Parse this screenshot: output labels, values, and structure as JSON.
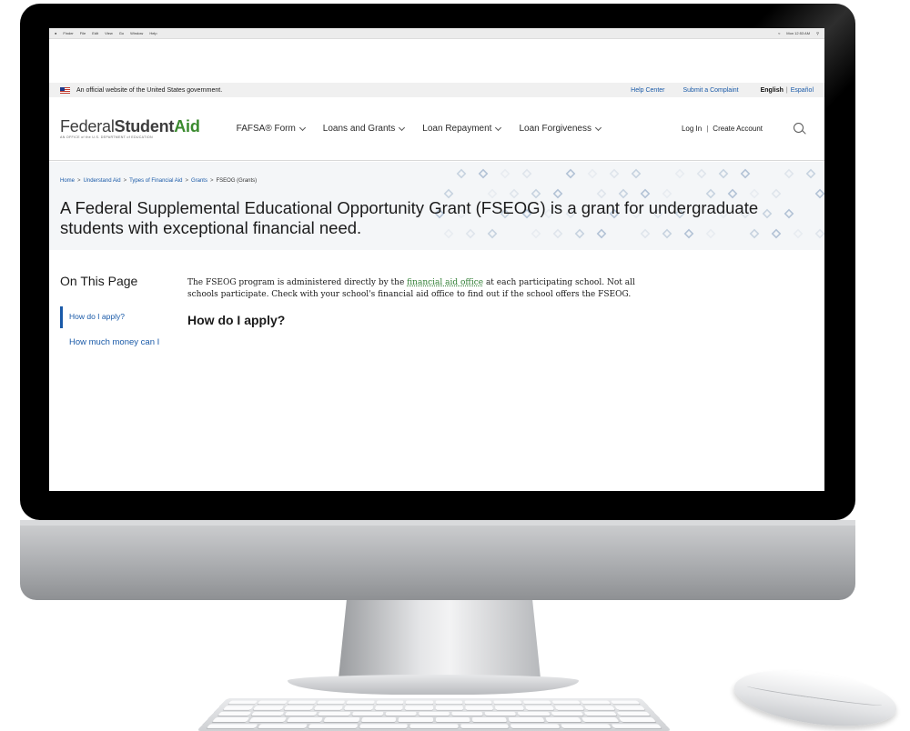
{
  "menubar": {
    "items": [
      "Finder",
      "File",
      "Edit",
      "View",
      "Go",
      "Window",
      "Help"
    ],
    "clock": "Mon 12:53 AM"
  },
  "gov_banner": {
    "notice": "An official website of the United States government.",
    "help_center": "Help Center",
    "submit_complaint": "Submit a Complaint",
    "lang_selected": "English",
    "lang_separator": "|",
    "lang_alternate": "Español"
  },
  "header": {
    "logo_federal": "Federal",
    "logo_student": "Student",
    "logo_aid": "Aid",
    "logo_subtitle": "AN OFFICE of the U.S. DEPARTMENT of EDUCATION",
    "nav": [
      {
        "label": "FAFSA® Form"
      },
      {
        "label": "Loans and Grants"
      },
      {
        "label": "Loan Repayment"
      },
      {
        "label": "Loan Forgiveness"
      }
    ],
    "login": "Log In",
    "separator": "|",
    "create_account": "Create Account"
  },
  "breadcrumb": {
    "items": [
      "Home",
      "Understand Aid",
      "Types of Financial Aid",
      "Grants"
    ],
    "current": "FSEOG (Grants)",
    "separator": ">"
  },
  "page": {
    "title": "A Federal Supplemental Educational Opportunity Grant (FSEOG) is a grant for undergraduate students with exceptional financial need."
  },
  "sidebar": {
    "title": "On This Page",
    "items": [
      {
        "label": "How do I apply?",
        "active": true
      },
      {
        "label": "How much money can I get?",
        "active": false
      }
    ]
  },
  "content": {
    "intro_before_link": "The FSEOG program is administered directly by the ",
    "intro_link": "financial aid office",
    "intro_after_link": " at each participating school. Not all schools participate. Check with your school's financial aid office to find out if the school offers the FSEOG.",
    "section_heading": "How do I apply?"
  },
  "colors": {
    "link_blue": "#1a5aa8",
    "logo_green": "#3a8a2e",
    "hero_bg": "#f4f6f8"
  }
}
